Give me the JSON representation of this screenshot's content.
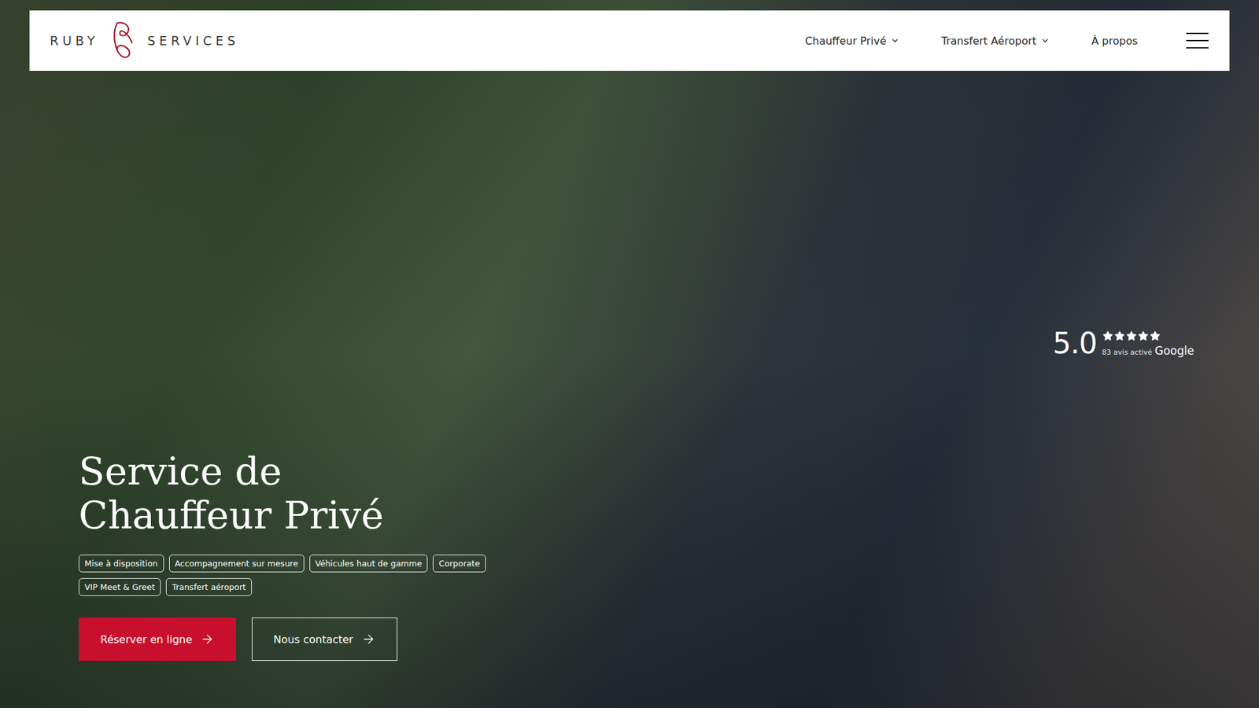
{
  "header": {
    "logo": {
      "left": "RUBY",
      "right": "SERVICES"
    },
    "nav": [
      {
        "label": "Chauffeur Privé",
        "dropdown": true
      },
      {
        "label": "Transfert Aéroport",
        "dropdown": true
      },
      {
        "label": "À propos",
        "dropdown": false
      }
    ]
  },
  "hero": {
    "title": [
      "Service de",
      "Chauffeur Privé"
    ],
    "tags": [
      "Mise à disposition",
      "Accompagnement sur mesure",
      "Véhicules haut de gamme",
      "Corporate",
      "VIP Meet & Greet",
      "Transfert aéroport"
    ],
    "buttons": [
      {
        "label": "Réserver en ligne",
        "kind": "primary"
      },
      {
        "label": "Nous contacter",
        "kind": "outline"
      }
    ]
  },
  "rating": {
    "score": "5.0",
    "stars": 5,
    "count": "83 avis activé",
    "source": "Google"
  }
}
